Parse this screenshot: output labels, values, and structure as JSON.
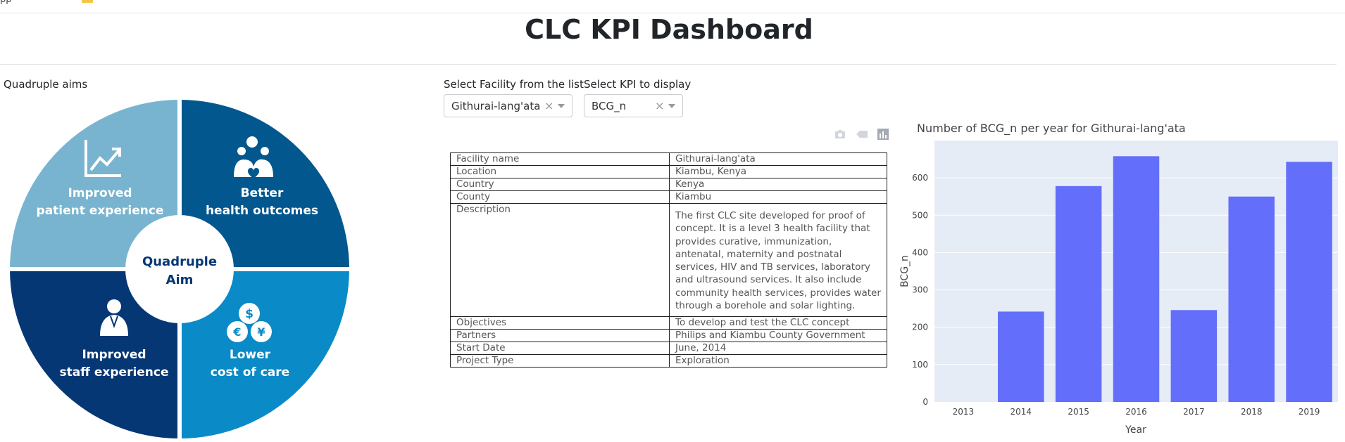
{
  "topbar": {
    "app_text": "pp"
  },
  "title": "CLC KPI Dashboard",
  "quad": {
    "label": "Quadruple aims",
    "center_line1": "Quadruple",
    "center_line2": "Aim",
    "quadrants": [
      {
        "line1": "Improved",
        "line2": "patient experience",
        "icon": "chart-arrow-icon",
        "color": "#78b4cf"
      },
      {
        "line1": "Better",
        "line2": "health outcomes",
        "icon": "people-heart-icon",
        "color": "#02578e"
      },
      {
        "line1": "Improved",
        "line2": "staff experience",
        "icon": "doctor-icon",
        "color": "#063775"
      },
      {
        "line1": "Lower",
        "line2": "cost of care",
        "icon": "currency-coins-icon",
        "color": "#0a8ac6"
      }
    ]
  },
  "controls": {
    "facility_label": "Select Facility from the list",
    "facility_value": "Githurai-lang'ata",
    "kpi_label": "Select KPI to display",
    "kpi_value": "BCG_n",
    "clear_glyph": "×"
  },
  "modebar": [
    "camera-icon",
    "tag-icon",
    "bar-chart-icon"
  ],
  "facility_table": [
    {
      "key": "Facility name",
      "value": "Githurai-lang'ata"
    },
    {
      "key": "Location",
      "value": "Kiambu, Kenya"
    },
    {
      "key": "Country",
      "value": "Kenya"
    },
    {
      "key": "County",
      "value": "Kiambu"
    },
    {
      "key": "Description",
      "value": "The first CLC site developed for proof of concept. It is a level 3 health facility that provides curative, immunization, antenatal, maternity and postnatal services, HIV and TB services, laboratory and ultrasound services. It also include community health services, provides water through a borehole and solar lighting."
    },
    {
      "key": "Objectives",
      "value": "To develop and test the CLC concept"
    },
    {
      "key": "Partners",
      "value": "Philips and Kiambu County Government"
    },
    {
      "key": "Start Date",
      "value": "June, 2014"
    },
    {
      "key": "Project Type",
      "value": "Exploration"
    }
  ],
  "chart_data": {
    "type": "bar",
    "title": "Number of BCG_n per year for Githurai-lang'ata",
    "xlabel": "Year",
    "ylabel": "BCG_n",
    "categories": [
      "2013",
      "2014",
      "2015",
      "2016",
      "2017",
      "2018",
      "2019"
    ],
    "values": [
      0,
      242,
      578,
      658,
      246,
      550,
      643
    ],
    "ylim": [
      0,
      700
    ],
    "yticks": [
      0,
      100,
      200,
      300,
      400,
      500,
      600
    ],
    "bar_color": "#636efa",
    "plot_bg": "#e5ecf6",
    "grid": true
  }
}
